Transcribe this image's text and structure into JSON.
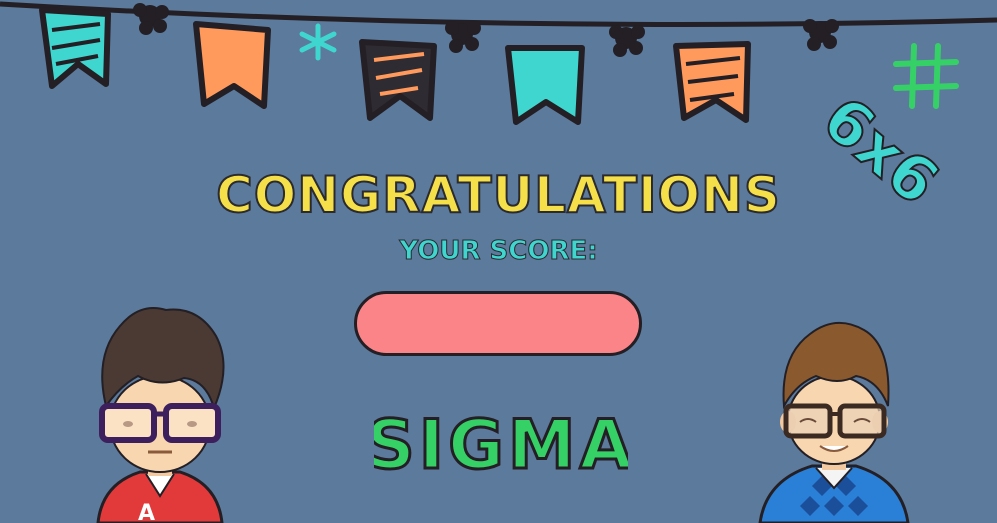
{
  "screen": {
    "title": "CONGRATULATIONS",
    "subtitle": "YOUR SCORE:",
    "score_value": "",
    "logo_text": "SIGMA"
  },
  "decor": {
    "corner_badge_icons": [
      "hash-icon",
      "six-x-six-icon"
    ]
  },
  "colors": {
    "background": "#5b7a9c",
    "title": "#f6e04a",
    "subtitle": "#3fd6d0",
    "score_box": "#fb8489",
    "logo_green": "#36d166",
    "teal": "#3fd6d0",
    "orange": "#ff9a5c",
    "outline": "#231f24"
  }
}
